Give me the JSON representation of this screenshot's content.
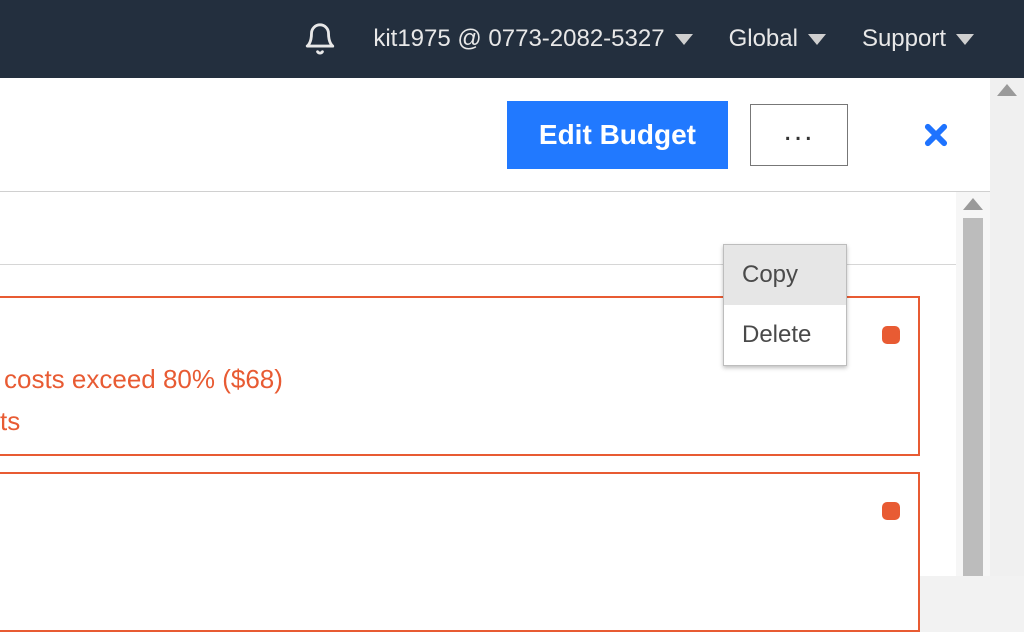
{
  "topbar": {
    "account_label": "kit1975 @ 0773-2082-5327",
    "region_label": "Global",
    "support_label": "Support"
  },
  "toolbar": {
    "edit_label": "Edit Budget",
    "more_label": "..."
  },
  "dropdown": {
    "copy_label": "Copy",
    "delete_label": "Delete"
  },
  "alerts": [
    {
      "line1": " costs exceed 80% ($68)",
      "line2": "ts"
    },
    {
      "line1": "",
      "line2": ""
    }
  ]
}
